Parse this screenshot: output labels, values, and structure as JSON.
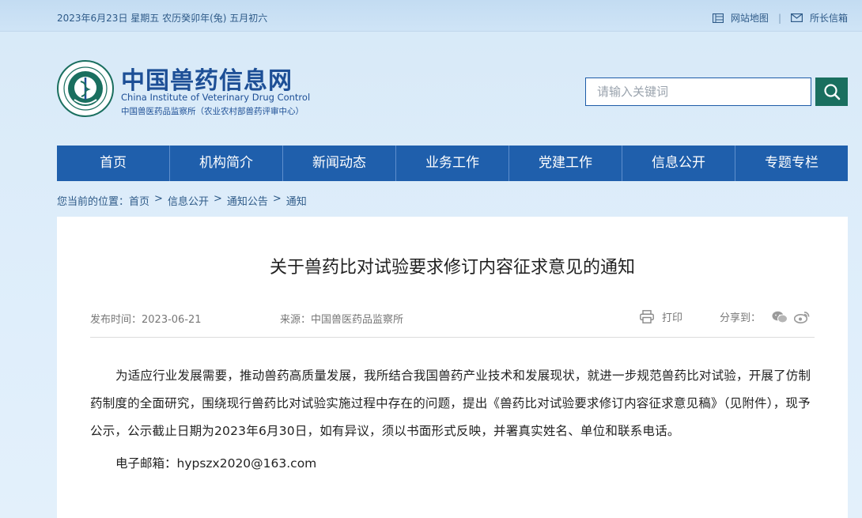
{
  "topbar": {
    "date": "2023年6月23日 星期五 农历癸卯年(兔) 五月初六",
    "sitemap": "网站地图",
    "separator": "|",
    "mailbox": "所长信箱"
  },
  "header": {
    "title_cn": "中国兽药信息网",
    "title_en": "China Institute of Veterinary Drug Control",
    "subtitle": "中国兽医药品监察所（农业农村部兽药评审中心）",
    "logo_icon": "emblem-logo"
  },
  "search": {
    "placeholder": "请输入关键词",
    "button_icon": "search-icon"
  },
  "nav": {
    "items": [
      "首页",
      "机构简介",
      "新闻动态",
      "业务工作",
      "党建工作",
      "信息公开",
      "专题专栏"
    ]
  },
  "breadcrumb": {
    "prefix": "您当前的位置：",
    "items": [
      "首页",
      "信息公开",
      "通知公告",
      "通知"
    ],
    "arrow": ">"
  },
  "article": {
    "title": "关于兽药比对试验要求修订内容征求意见的通知",
    "publish": "发布时间：2023-06-21",
    "source": "来源：中国兽医药品监察所",
    "print": "打印",
    "share": "分享到：",
    "body": "为适应行业发展需要，推动兽药高质量发展，我所结合我国兽药产业技术和发展现状，就进一步规范兽药比对试验，开展了仿制药制度的全面研究，围绕现行兽药比对试验实施过程中存在的问题，提出《兽药比对试验要求修订内容征求意见稿》（见附件），现予公示，公示截止日期为2023年6月30日，如有异议，须以书面形式反映，并署真实姓名、单位和联系电话。",
    "email": "电子邮箱：hypszx2020@163.com"
  },
  "colors": {
    "nav_bg": "#1f5fac",
    "brand": "#1d4f96",
    "search_btn": "#1a6f5f"
  }
}
